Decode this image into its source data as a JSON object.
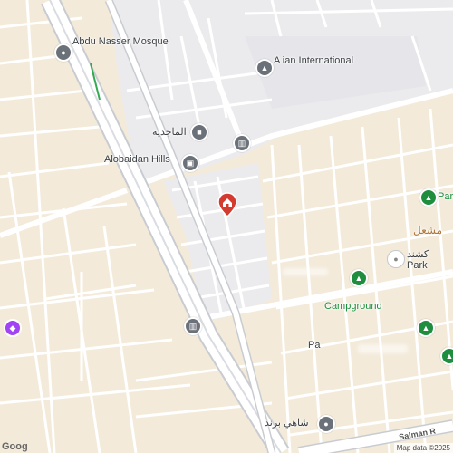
{
  "map": {
    "colors": {
      "land": "#f3ead9",
      "urban": "#ebebee",
      "road": "#ffffff",
      "highway": "#c8ccd1",
      "marker": "#d33b30"
    },
    "places": [
      {
        "name": "Abdu Nasser Mosque",
        "icon": "mosque-icon"
      },
      {
        "name": "A  ian International",
        "icon": "school-icon"
      },
      {
        "name": "الماجدية",
        "icon": "landmark-icon"
      },
      {
        "name": "Alobaidan Hills",
        "icon": "building-icon"
      },
      {
        "name": "",
        "icon": "museum-icon"
      },
      {
        "name": "",
        "icon": "museum-icon"
      },
      {
        "name": "Park",
        "icon": "park-icon"
      },
      {
        "name": "مشعل",
        "icon": "cafe-icon"
      },
      {
        "name": "كشند",
        "icon": "shop-icon"
      },
      {
        "name": "Park",
        "icon": "park-icon"
      },
      {
        "name": "",
        "icon": "park-icon"
      },
      {
        "name": "Campground",
        "icon": "campground-icon"
      },
      {
        "name": "Pa",
        "icon": ""
      },
      {
        "name": "",
        "icon": "park-icon"
      },
      {
        "name": "شاهي برند",
        "icon": "shop-icon"
      },
      {
        "name": "",
        "icon": "shop-icon"
      },
      {
        "name": "",
        "icon": "shopping-icon"
      }
    ],
    "selected": {
      "name": "",
      "icon": "home-icon"
    },
    "road_label": "Salman R",
    "attribution": "Map data ©2025",
    "logo": "Goog"
  }
}
